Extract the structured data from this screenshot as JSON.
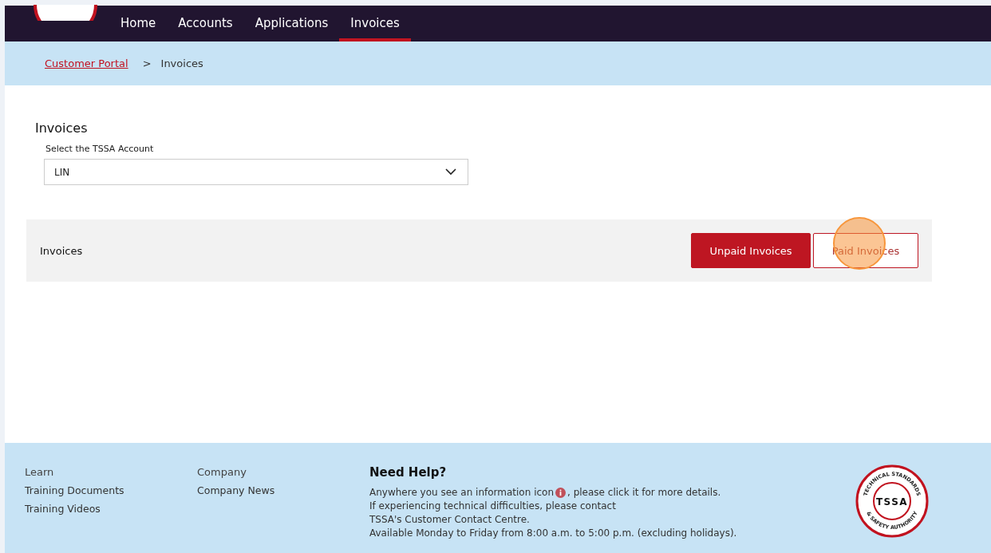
{
  "nav": {
    "tabs": [
      {
        "label": "Home",
        "selected": false
      },
      {
        "label": "Accounts",
        "selected": false
      },
      {
        "label": "Applications",
        "selected": false
      },
      {
        "label": "Invoices",
        "selected": true
      }
    ]
  },
  "breadcrumb": {
    "link": "Customer Portal",
    "separator": ">",
    "current": "Invoices"
  },
  "page": {
    "title": "Invoices",
    "account_label": "Select the TSSA Account",
    "account_value": "LIN"
  },
  "invoices_panel": {
    "title": "Invoices",
    "buttons": [
      {
        "label": "Unpaid Invoices",
        "selected": true
      },
      {
        "label": "Paid Invoices",
        "selected": false
      }
    ]
  },
  "footer": {
    "learn": {
      "heading": "Learn",
      "links": [
        "Training Documents",
        "Training Videos"
      ]
    },
    "company": {
      "heading": "Company",
      "links": [
        "Company News"
      ]
    },
    "help": {
      "heading": "Need Help?",
      "line_1_before": "Anywhere you see an information icon",
      "line_1_after": ", please click it for more details.",
      "lines": [
        "If experiencing technical difficulties, please contact",
        "TSSA's Customer Contact Centre.",
        "Available Monday to Friday from 8:00 a.m. to 5:00 p.m. (excluding holidays)."
      ]
    },
    "logo": {
      "top": "TECHNICAL STANDARDS",
      "bottom": "& SAFETY AUTHORITY",
      "center": "TSSA"
    }
  }
}
